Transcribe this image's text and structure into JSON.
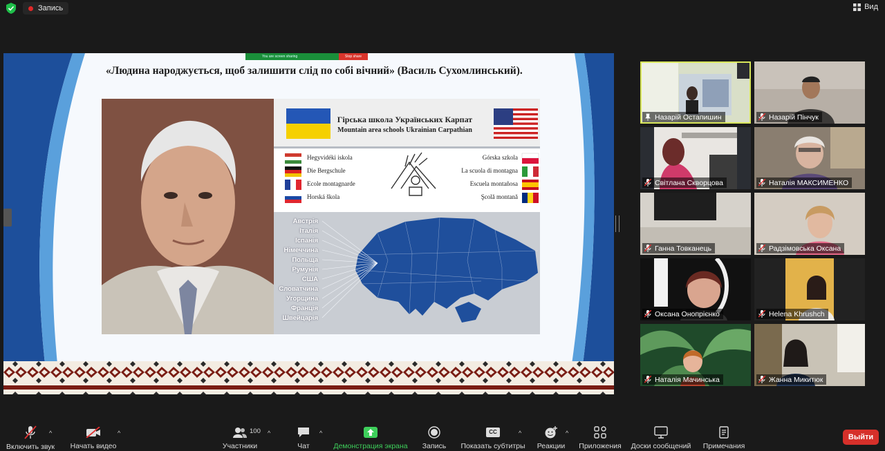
{
  "topbar": {
    "recording_label": "Запись",
    "view_label": "Вид"
  },
  "share": {
    "sharing_notice": "You are screen sharing",
    "stop_share": "Stop share",
    "slide": {
      "quote": "«Людина народжується, щоб залишити слід по собі вічний» (Василь Сухомлинський).",
      "title_ua": "Гірська школа Українських Карпат",
      "title_en": "Mountain area schools Ukrainian Carpathian",
      "schools_left": [
        "Hegyvidéki iskola",
        "Die Bergschule",
        "Ecole montagnarde",
        "Horská škola"
      ],
      "schools_right": [
        "Górska szkola",
        "La scuola di montagna",
        "Escuela montañosa",
        "Şcolă montană"
      ],
      "countries": [
        "Австрія",
        "Італія",
        "Іспанія",
        "Німеччина",
        "Польща",
        "Румунія",
        "США",
        "Словатчина",
        "Угорщина",
        "Франція",
        "Швейцарія"
      ]
    }
  },
  "participants": [
    {
      "name": "Назарій Остапишин",
      "muted": false,
      "active": true
    },
    {
      "name": "Назарій Пінчук",
      "muted": true,
      "active": false
    },
    {
      "name": "Світлана Скворцова",
      "muted": true,
      "active": false
    },
    {
      "name": "Наталія МАКСИМЕНКО",
      "muted": true,
      "active": false
    },
    {
      "name": "Ганна Товканець",
      "muted": true,
      "active": false
    },
    {
      "name": "Радзімовська Оксана",
      "muted": true,
      "active": false
    },
    {
      "name": "Оксана Онопрієнко",
      "muted": true,
      "active": false
    },
    {
      "name": "Helena Khrushch",
      "muted": true,
      "active": false
    },
    {
      "name": "Наталія Мачинська",
      "muted": true,
      "active": false
    },
    {
      "name": "Жанна Микитюк",
      "muted": true,
      "active": false
    }
  ],
  "toolbar": {
    "unmute": "Включить звук",
    "start_video": "Начать видео",
    "participants": "Участники",
    "participants_count": "100",
    "chat": "Чат",
    "share_screen": "Демонстрация экрана",
    "record": "Запись",
    "captions": "Показать субтитры",
    "captions_icon_text": "CC",
    "reactions": "Реакции",
    "apps": "Приложения",
    "whiteboards": "Доски сообщений",
    "notes": "Примечания",
    "leave": "Выйти"
  },
  "colors": {
    "accent_green": "#3ecf5b",
    "leave_red": "#d6302a",
    "active_speaker": "#d8e65a",
    "slide_blue": "#1f4e9a"
  }
}
